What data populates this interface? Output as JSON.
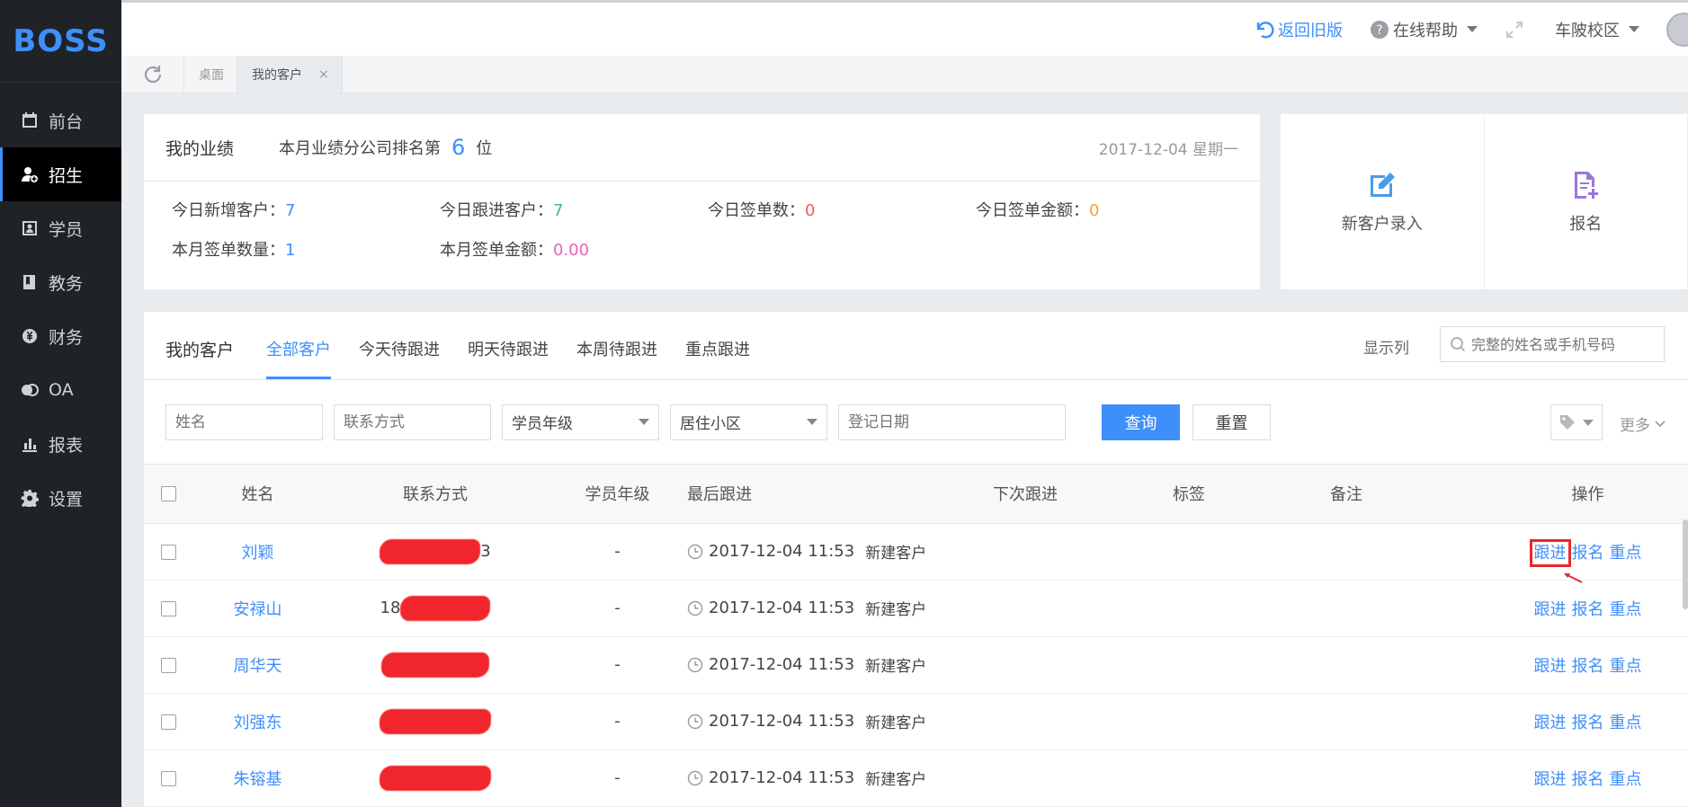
{
  "app": {
    "logo": "BOSS"
  },
  "sidebar": {
    "items": [
      {
        "label": "前台",
        "icon": "calendar-icon"
      },
      {
        "label": "招生",
        "icon": "user-add-icon",
        "active": true
      },
      {
        "label": "学员",
        "icon": "id-card-icon"
      },
      {
        "label": "教务",
        "icon": "book-icon"
      },
      {
        "label": "财务",
        "icon": "yen-icon"
      },
      {
        "label": "OA",
        "icon": "oa-icon"
      },
      {
        "label": "报表",
        "icon": "bar-chart-icon"
      },
      {
        "label": "设置",
        "icon": "gear-icon"
      }
    ]
  },
  "header": {
    "return_old": "返回旧版",
    "help": "在线帮助",
    "campus": "车陂校区"
  },
  "tabs": [
    {
      "label": "桌面"
    },
    {
      "label": "我的客户",
      "active": true,
      "close": "×"
    }
  ],
  "performance": {
    "title": "我的业绩",
    "rank_prefix": "本月业绩分公司排名第",
    "rank": "6",
    "rank_suffix": "位",
    "date": "2017-12-04 星期一",
    "stats": [
      {
        "label": "今日新增客户：",
        "value": "7"
      },
      {
        "label": "今日跟进客户：",
        "value": "7"
      },
      {
        "label": "今日签单数：",
        "value": "0"
      },
      {
        "label": "今日签单金额：",
        "value": "0"
      },
      {
        "label": "本月签单数量：",
        "value": "1"
      },
      {
        "label": "本月签单金额：",
        "value": "0.00"
      }
    ]
  },
  "quick_actions": [
    {
      "label": "新客户录入",
      "icon": "edit-icon"
    },
    {
      "label": "报名",
      "icon": "document-add-icon"
    }
  ],
  "customers": {
    "title": "我的客户",
    "tabs": [
      "全部客户",
      "今天待跟进",
      "明天待跟进",
      "本周待跟进",
      "重点跟进"
    ],
    "show_columns": "显示列",
    "search_placeholder": "完整的姓名或手机号码",
    "filters": {
      "name_placeholder": "姓名",
      "contact_placeholder": "联系方式",
      "grade": "学员年级",
      "community": "居住小区",
      "reg_date_placeholder": "登记日期",
      "query": "查询",
      "reset": "重置",
      "more": "更多"
    },
    "columns": [
      "姓名",
      "联系方式",
      "学员年级",
      "最后跟进",
      "下次跟进",
      "标签",
      "备注",
      "操作"
    ],
    "rows": [
      {
        "name": "刘颖",
        "contact_visible": "3",
        "grade": "-",
        "last_follow": "2017-12-04 11:53",
        "follow_type": "新建客户"
      },
      {
        "name": "安禄山",
        "contact_visible": "18",
        "grade": "-",
        "last_follow": "2017-12-04 11:53",
        "follow_type": "新建客户"
      },
      {
        "name": "周华天",
        "contact_visible": "",
        "grade": "-",
        "last_follow": "2017-12-04 11:53",
        "follow_type": "新建客户"
      },
      {
        "name": "刘强东",
        "contact_visible": "",
        "grade": "-",
        "last_follow": "2017-12-04 11:53",
        "follow_type": "新建客户"
      },
      {
        "name": "朱镕基",
        "contact_visible": "",
        "grade": "-",
        "last_follow": "2017-12-04 11:53",
        "follow_type": "新建客户"
      }
    ],
    "ops": {
      "follow": "跟进",
      "enroll": "报名",
      "focus": "重点"
    }
  },
  "colors": {
    "accent": "#3f8ffb",
    "sidebar_bg": "#1f2328",
    "highlight": "#e7272c"
  }
}
